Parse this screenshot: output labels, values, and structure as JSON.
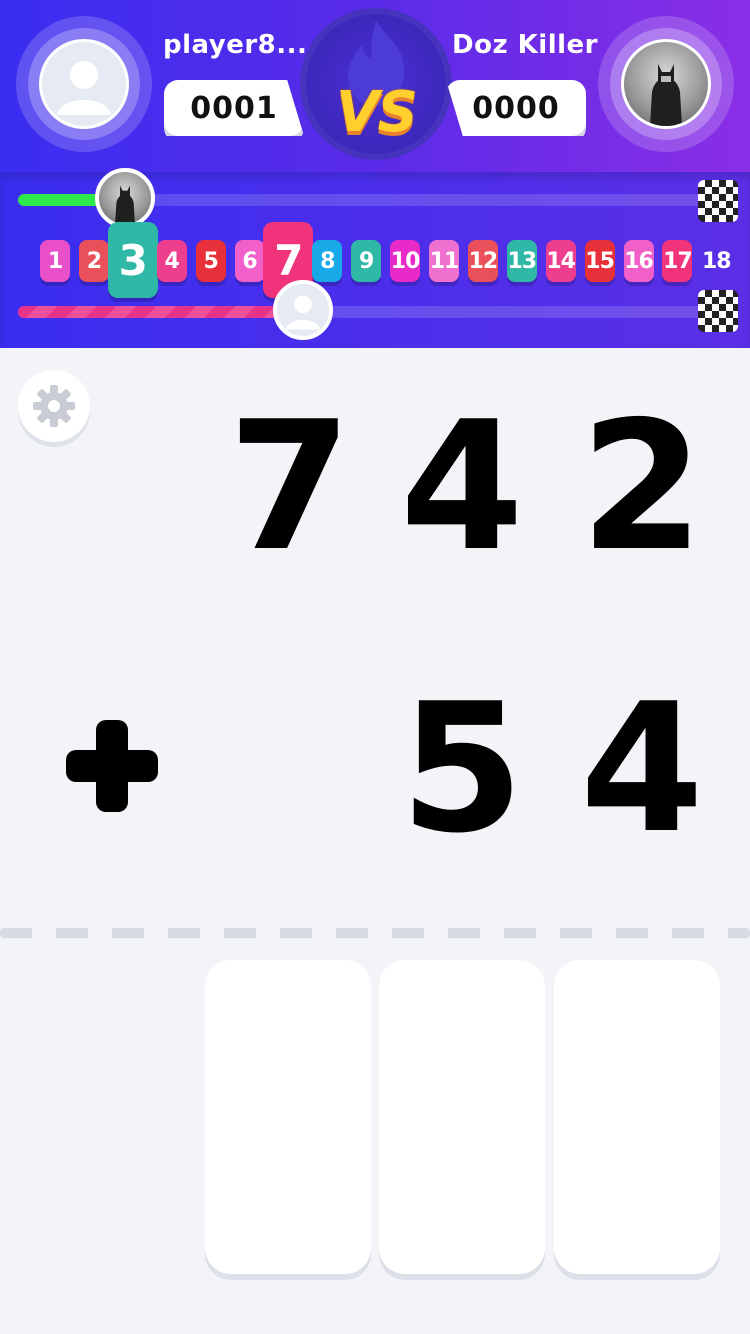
{
  "header": {
    "player_left": {
      "name": "player8...",
      "score": "0001"
    },
    "player_right": {
      "name": "Doz Killer",
      "score": "0000"
    },
    "vs_label": "VS"
  },
  "progress": {
    "top_track_progress": 0.13,
    "bottom_track_progress": 0.39,
    "levels": [
      {
        "label": "1",
        "color": "#e84fc8"
      },
      {
        "label": "2",
        "color": "#e9505a"
      },
      {
        "label": "3",
        "color": "#2fb8a6",
        "current_top": true
      },
      {
        "label": "4",
        "color": "#ee3f8f"
      },
      {
        "label": "5",
        "color": "#e8303a"
      },
      {
        "label": "6",
        "color": "#f060c8"
      },
      {
        "label": "7",
        "color": "#f0337a",
        "current_bottom": true
      },
      {
        "label": "8",
        "color": "#18a9e8"
      },
      {
        "label": "9",
        "color": "#2fb8a6"
      },
      {
        "label": "10",
        "color": "#e82ac8"
      },
      {
        "label": "11",
        "color": "#f070d0"
      },
      {
        "label": "12",
        "color": "#e9505a"
      },
      {
        "label": "13",
        "color": "#2fb8a6"
      },
      {
        "label": "14",
        "color": "#ee3f8f"
      },
      {
        "label": "15",
        "color": "#e8303a"
      },
      {
        "label": "16",
        "color": "#f060c8"
      },
      {
        "label": "17",
        "color": "#f0337a"
      },
      {
        "label": "18",
        "color": "transparent"
      }
    ]
  },
  "problem": {
    "top_digits": [
      "7",
      "4",
      "2"
    ],
    "operator": "+",
    "bottom_digits": [
      "5",
      "4"
    ],
    "answer_slots": 3
  },
  "icons": {
    "settings": "gear-icon",
    "finish": "checkered-flag-icon",
    "vs": "flame-icon"
  },
  "colors": {
    "header_start": "#3a2ef0",
    "header_end": "#8a2ee6",
    "progress_top": "#2ee84b",
    "progress_bottom": "#e8338a",
    "vs_text": "#ffcf2e"
  }
}
